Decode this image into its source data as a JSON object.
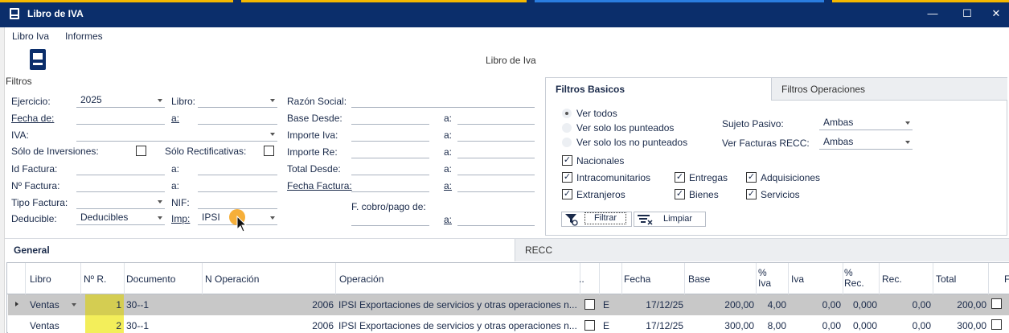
{
  "window": {
    "title": "Libro de IVA",
    "minimize": "—",
    "maximize": "☐",
    "close": "✕"
  },
  "menu": {
    "items": [
      "Libro Iva",
      "Informes"
    ]
  },
  "toolbar": {
    "filters_label": "Filtros",
    "center_title": "Libro de Iva"
  },
  "filters": {
    "ejercicio_label": "Ejercicio:",
    "ejercicio_value": "2025",
    "libro_label": "Libro:",
    "libro_value": "",
    "razon_label": "Razón Social:",
    "fecha_de_label": "Fecha de:",
    "a_label": "a:",
    "base_desde_label": "Base Desde:",
    "iva_label": "IVA:",
    "importe_iva_label": "Importe Iva:",
    "solo_inversiones_label": "Sólo de Inversiones:",
    "solo_rectificativas_label": "Sólo Rectificativas:",
    "importe_re_label": "Importe Re:",
    "id_factura_label": "Id Factura:",
    "total_desde_label": "Total Desde:",
    "n_factura_label": "Nº Factura:",
    "fecha_factura_label": "Fecha Factura:",
    "tipo_factura_label": "Tipo Factura:",
    "nif_label": "NIF:",
    "cobro_pago_label": "F. cobro/pago de:",
    "deducible_label": "Deducible:",
    "deducible_value": "Deducibles",
    "imp_label": "Imp:",
    "imp_value": "IPSI"
  },
  "filter_panel": {
    "tab_basic": "Filtros Basicos",
    "tab_ops": "Filtros Operaciones",
    "radio_all": "Ver todos",
    "radio_dotted": "Ver solo los punteados",
    "radio_notdotted": "Ver solo los no punteados",
    "sujeto_label": "Sujeto Pasivo:",
    "sujeto_value": "Ambas",
    "recc_label": "Ver Facturas RECC:",
    "recc_value": "Ambas",
    "nacionales": "Nacionales",
    "intracom": "Intracomunitarios",
    "extranjeros": "Extranjeros",
    "entregas": "Entregas",
    "bienes": "Bienes",
    "adquisiciones": "Adquisiciones",
    "servicios": "Servicios",
    "filter_button": "Filtrar",
    "clear_button": "Limpiar",
    "check_mark": "✓"
  },
  "result_tabs": {
    "general": "General",
    "recc": "RECC"
  },
  "table": {
    "headers": [
      "Libro",
      "Nº R.",
      "Documento",
      "N Operación",
      "Operación",
      "..",
      "",
      "Fecha",
      "Base",
      "% Iva",
      "Iva",
      "% Rec.",
      "Rec.",
      "Total",
      "F"
    ],
    "rows": [
      {
        "libro": "Ventas",
        "nr": "1",
        "documento": "30--1",
        "n_operacion": "2006",
        "operacion": "IPSI Exportaciones de servicios y otras operaciones n...",
        "e": "E",
        "fecha": "17/12/25",
        "base": "200,00",
        "pct_iva": "4,00",
        "iva": "0,00",
        "pct_rec": "0,000",
        "rec": "0,00",
        "total": "200,00"
      },
      {
        "libro": "Ventas",
        "nr": "2",
        "documento": "30--1",
        "n_operacion": "2006",
        "operacion": "IPSI Exportaciones de servicios y otras operaciones n...",
        "e": "E",
        "fecha": "17/12/25",
        "base": "300,00",
        "pct_iva": "8,00",
        "iva": "0,00",
        "pct_rec": "0,000",
        "rec": "0,00",
        "total": "300,00"
      }
    ]
  },
  "colors": {
    "titlebar": "#0b2e6b",
    "highlight_nr": "#f3ee5a",
    "cursor_dot": "#f5a623"
  }
}
